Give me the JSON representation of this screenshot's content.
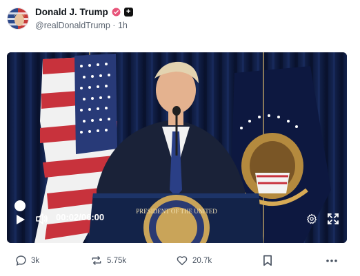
{
  "post": {
    "author_name": "Donald J. Trump",
    "handle": "@realDonaldTrump",
    "separator": "·",
    "time_ago": "1h"
  },
  "video": {
    "current_time": "00:02",
    "time_separator": "/",
    "duration": "06:00",
    "progress": 0.006,
    "podium_seal_text": "PRESIDENT OF THE UNITED"
  },
  "actions": {
    "replies": "3k",
    "reposts": "5.75k",
    "likes": "20.7k"
  },
  "colors": {
    "verified": "#e8547a",
    "text_muted": "#5b6470",
    "video_bg": "#0b1530"
  },
  "icons": [
    "verified-icon",
    "plus-icon",
    "play-icon",
    "volume-icon",
    "settings-icon",
    "fullscreen-icon",
    "reply-icon",
    "repost-icon",
    "like-icon",
    "bookmark-icon",
    "more-icon"
  ]
}
